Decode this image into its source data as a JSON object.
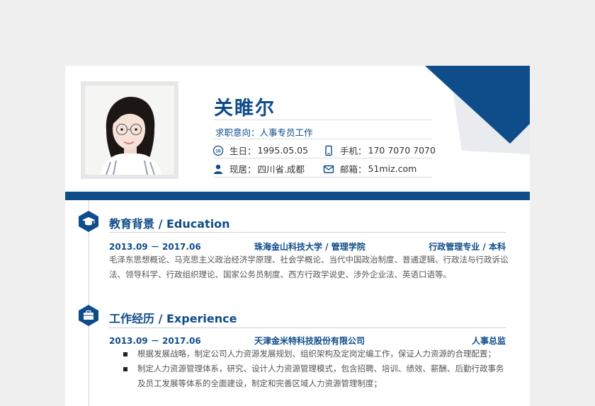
{
  "profile": {
    "name": "关睢尔",
    "intent": "求职意向：人事专员工作",
    "birth_label": "生日：",
    "birth": "1995.05.05",
    "phone_label": "手机：",
    "phone": "170 7070 7070",
    "location_label": "现居：",
    "location": "四川省.成都",
    "email_label": "邮箱：",
    "email": "51miz.com",
    "age_badge": "16"
  },
  "education": {
    "title": "教育背景 / Education",
    "period": "2013.09 － 2017.06",
    "school": "珠海金山科技大学 / 管理学院",
    "major": "行政管理专业 / 本科",
    "courses": "毛泽东思想概论、马克思主义政治经济学原理、社会学概论、当代中国政治制度、普通逻辑、行政法与行政诉讼法、领导科学、行政组织理论、国家公务员制度、西方行政学说史、涉外企业法、英语口语等。"
  },
  "experience": {
    "title": "工作经历 / Experience",
    "period": "2013.09 － 2017.06",
    "company": "天津金米特科技股份有限公司",
    "position": "人事总监",
    "bullets": [
      "根据发展战略，制定公司人力资源发展规划、组织架构及定岗定编工作，保证人力资源的合理配置；",
      "制定人力资源管理体系，研究、设计人力资源管理模式，包含招聘、培训、绩效、薪酬、后勤行政事务及员工发展等体系的全面建设，制定和完善区域人力资源管理制度；"
    ]
  },
  "colors": {
    "primary": "#0f4c8a",
    "decoGray": "#e9ebee"
  }
}
